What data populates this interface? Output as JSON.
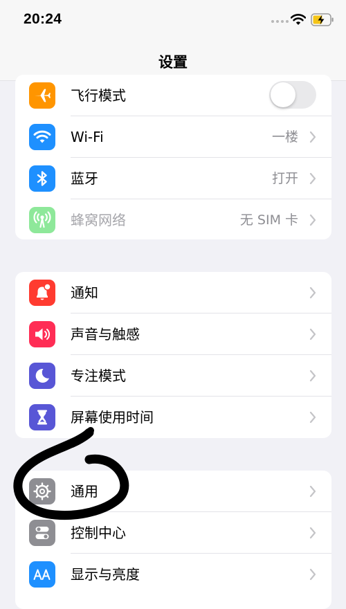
{
  "status_bar": {
    "time": "20:24"
  },
  "nav": {
    "title": "设置"
  },
  "groups": [
    {
      "rows": [
        {
          "label": "飞行模式",
          "control": "toggle",
          "toggle_on": false,
          "icon": "airplane-icon",
          "icon_color": "#ff9500"
        },
        {
          "label": "Wi-Fi",
          "value": "一楼",
          "icon": "wifi-icon",
          "icon_color": "#1e90ff"
        },
        {
          "label": "蓝牙",
          "value": "打开",
          "icon": "bluetooth-icon",
          "icon_color": "#1e90ff"
        },
        {
          "label": "蜂窝网络",
          "value": "无 SIM 卡",
          "icon": "cellular-icon",
          "icon_color": "#8ee89a",
          "disabled": true
        }
      ]
    },
    {
      "rows": [
        {
          "label": "通知",
          "icon": "notification-bell-icon",
          "icon_color": "#ff3b30"
        },
        {
          "label": "声音与触感",
          "icon": "speaker-icon",
          "icon_color": "#ff2d55"
        },
        {
          "label": "专注模式",
          "icon": "moon-icon",
          "icon_color": "#5856d6"
        },
        {
          "label": "屏幕使用时间",
          "icon": "hourglass-icon",
          "icon_color": "#5856d6"
        }
      ]
    },
    {
      "rows": [
        {
          "label": "通用",
          "icon": "gear-icon",
          "icon_color": "#8e8e93"
        },
        {
          "label": "控制中心",
          "icon": "toggles-icon",
          "icon_color": "#8e8e93"
        },
        {
          "label": "显示与亮度",
          "icon": "text-size-icon",
          "icon_color": "#1e90ff"
        }
      ]
    }
  ],
  "annotation": {
    "kind": "hand-drawn black circle",
    "target": "通用"
  }
}
